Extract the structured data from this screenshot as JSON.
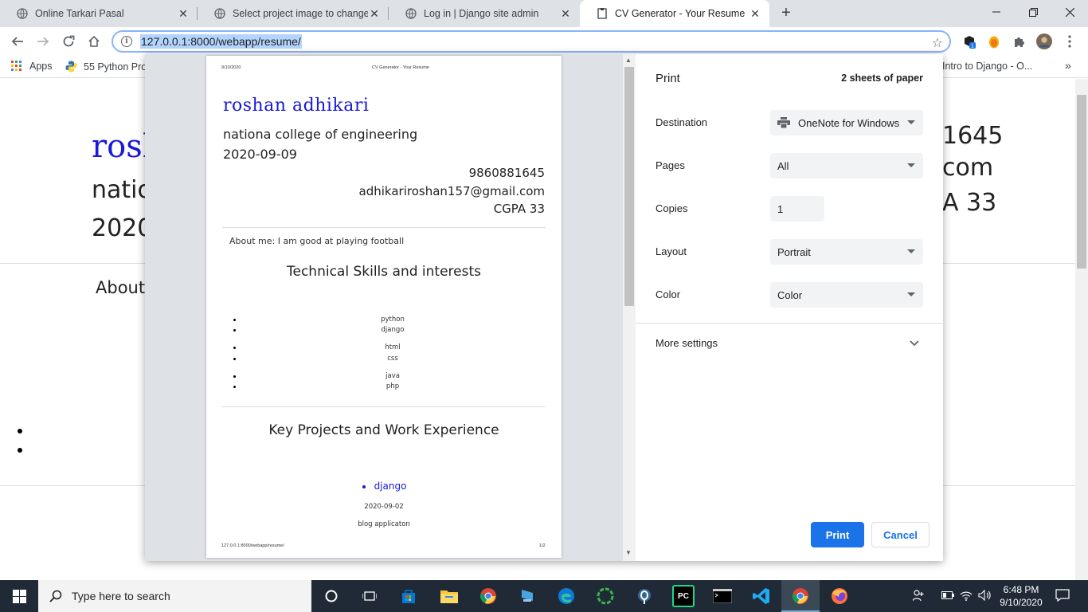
{
  "browser": {
    "tabs": [
      {
        "title": "Online Tarkari Pasal",
        "active": false
      },
      {
        "title": "Select project image to change |",
        "active": false
      },
      {
        "title": "Log in | Django site admin",
        "active": false
      },
      {
        "title": "CV Generator - Your Resume",
        "active": true
      }
    ],
    "url": "127.0.0.1:8000/webapp/resume/",
    "bookmarks": {
      "apps": "Apps",
      "python": "55 Python Proj",
      "django_intro": "Intro to Django - O...",
      "overflow": "»"
    }
  },
  "background_page": {
    "name_partial": "rosh",
    "line1_partial": "natio",
    "line2_partial": "2020",
    "right1": "1645",
    "right2": "com",
    "right3": "A 33",
    "about_partial": "About"
  },
  "preview": {
    "header_date": "9/10/2020",
    "header_title": "CV Generator - Your Resume",
    "name": "roshan adhikari",
    "college": "nationa college of engineering",
    "date": "2020-09-09",
    "phone": "9860881645",
    "email": "adhikariroshan157@gmail.com",
    "cgpa": "CGPA 33",
    "about": "About me: I am good at playing football",
    "skills_heading": "Technical Skills and interests",
    "skills": [
      "python",
      "django",
      "html",
      "css",
      "java",
      "php"
    ],
    "projects_heading": "Key Projects and Work Experience",
    "project_name": "django",
    "project_date": "2020-09-02",
    "project_desc": "blog applicaton",
    "footer_url": "127.0.0.1:8000/webapp/resume/",
    "footer_page": "1/2"
  },
  "print_settings": {
    "title": "Print",
    "sheets": "2 sheets of paper",
    "destination_label": "Destination",
    "destination_value": "OneNote for Windows",
    "pages_label": "Pages",
    "pages_value": "All",
    "copies_label": "Copies",
    "copies_value": "1",
    "layout_label": "Layout",
    "layout_value": "Portrait",
    "color_label": "Color",
    "color_value": "Color",
    "more_settings": "More settings",
    "print_button": "Print",
    "cancel_button": "Cancel"
  },
  "taskbar": {
    "search_placeholder": "Type here to search",
    "time": "6:48 PM",
    "date": "9/10/2020"
  },
  "colors": {
    "accent": "#1a73e8",
    "name_blue": "#1a1ad6",
    "taskbar": "#1f2a36"
  }
}
